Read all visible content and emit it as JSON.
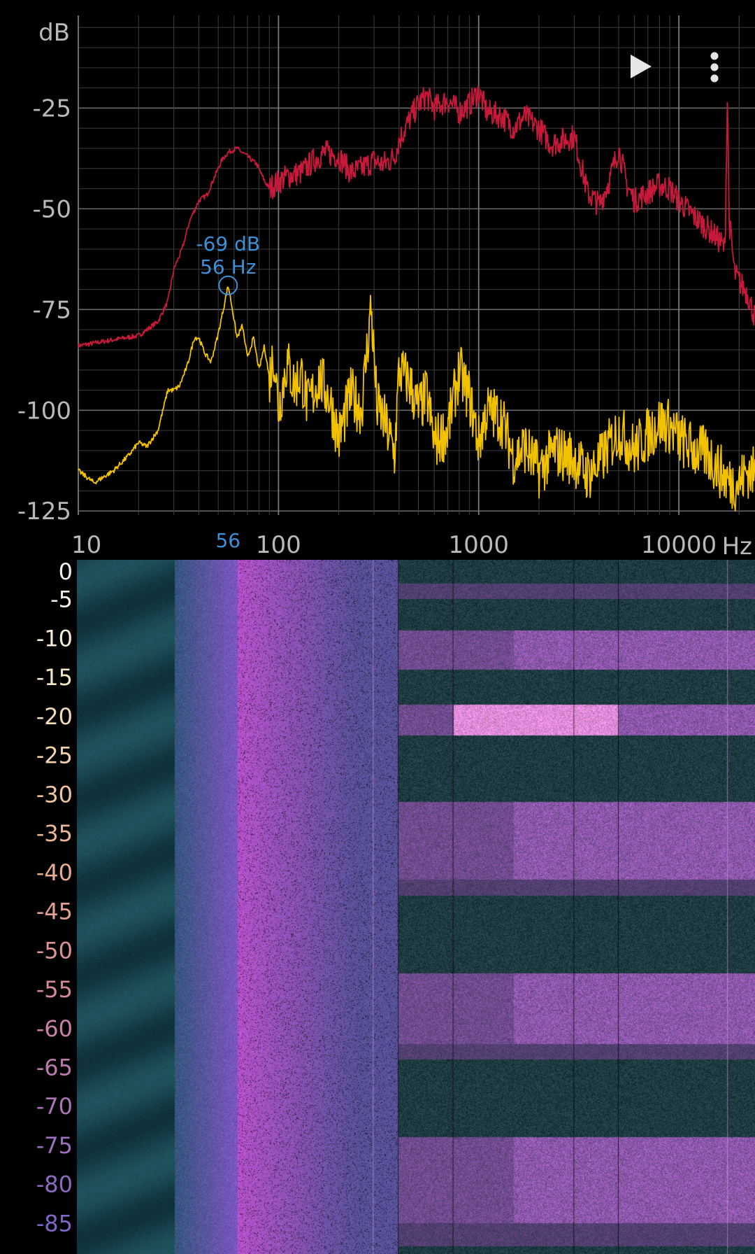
{
  "toolbar": {
    "play_icon": "play-icon",
    "menu_icon": "more-vertical-icon"
  },
  "marker": {
    "db_label": "-69 dB",
    "hz_label": "56 Hz",
    "freq_tick": "56",
    "freq_hz": 56,
    "db_value": -69,
    "color": "#3d8fd6"
  },
  "chart_data": [
    {
      "type": "line",
      "title": "",
      "xscale": "log",
      "xlim": [
        10,
        24000
      ],
      "ylim": [
        -126,
        -2
      ],
      "ylabel": "dB",
      "xlabel": "Hz",
      "y_ticks": [
        {
          "label": "-25",
          "value": -25
        },
        {
          "label": "-50",
          "value": -50
        },
        {
          "label": "-75",
          "value": -75
        },
        {
          "label": "-100",
          "value": -100
        },
        {
          "label": "-125",
          "value": -125
        }
      ],
      "x_ticks": [
        {
          "label": "10",
          "value": 10
        },
        {
          "label": "100",
          "value": 100
        },
        {
          "label": "1000",
          "value": 1000
        },
        {
          "label": "10000",
          "value": 10000
        }
      ],
      "grid": true,
      "series": [
        {
          "color": "#c8193a",
          "points": [
            [
              10,
              -84
            ],
            [
              15,
              -82.5
            ],
            [
              20,
              -81.5
            ],
            [
              25,
              -78
            ],
            [
              28,
              -73
            ],
            [
              30,
              -65
            ],
            [
              33,
              -60
            ],
            [
              36,
              -53
            ],
            [
              40,
              -48
            ],
            [
              44,
              -46.5
            ],
            [
              48,
              -42
            ],
            [
              52,
              -38
            ],
            [
              56,
              -36
            ],
            [
              62,
              -35
            ],
            [
              70,
              -37
            ],
            [
              78,
              -39
            ],
            [
              85,
              -43
            ],
            [
              90,
              -45
            ],
            [
              95,
              -44
            ],
            [
              110,
              -42
            ],
            [
              130,
              -41
            ],
            [
              150,
              -38
            ],
            [
              170,
              -36
            ],
            [
              200,
              -37
            ],
            [
              230,
              -41
            ],
            [
              260,
              -40
            ],
            [
              300,
              -38
            ],
            [
              330,
              -39
            ],
            [
              360,
              -38
            ],
            [
              380,
              -37
            ],
            [
              400,
              -33
            ],
            [
              450,
              -28
            ],
            [
              500,
              -24
            ],
            [
              550,
              -22
            ],
            [
              600,
              -25
            ],
            [
              700,
              -23
            ],
            [
              800,
              -26
            ],
            [
              900,
              -24
            ],
            [
              1000,
              -21
            ],
            [
              1100,
              -26
            ],
            [
              1300,
              -27
            ],
            [
              1500,
              -30
            ],
            [
              1700,
              -27
            ],
            [
              2000,
              -30
            ],
            [
              2300,
              -34
            ],
            [
              2600,
              -33
            ],
            [
              3000,
              -32
            ],
            [
              3500,
              -46
            ],
            [
              4000,
              -49
            ],
            [
              4500,
              -43
            ],
            [
              5000,
              -35
            ],
            [
              5500,
              -44
            ],
            [
              6000,
              -48
            ],
            [
              7000,
              -46
            ],
            [
              8000,
              -44
            ],
            [
              9000,
              -45
            ],
            [
              10000,
              -48
            ],
            [
              12000,
              -52
            ],
            [
              14000,
              -55
            ],
            [
              16000,
              -58
            ],
            [
              17000,
              -60
            ],
            [
              17500,
              -20
            ],
            [
              17800,
              -52
            ],
            [
              18000,
              -55
            ],
            [
              19000,
              -66
            ],
            [
              20000,
              -68
            ],
            [
              22000,
              -71
            ],
            [
              24000,
              -77
            ]
          ]
        },
        {
          "color": "#f2c200",
          "points": [
            [
              10,
              -115
            ],
            [
              12,
              -118
            ],
            [
              15,
              -115
            ],
            [
              18,
              -111
            ],
            [
              20,
              -108
            ],
            [
              22,
              -109
            ],
            [
              25,
              -105
            ],
            [
              28,
              -95
            ],
            [
              30,
              -95
            ],
            [
              32,
              -94
            ],
            [
              35,
              -89
            ],
            [
              38,
              -82
            ],
            [
              40,
              -82
            ],
            [
              43,
              -86
            ],
            [
              46,
              -88
            ],
            [
              50,
              -81
            ],
            [
              53,
              -75
            ],
            [
              56,
              -69
            ],
            [
              58,
              -73
            ],
            [
              62,
              -82
            ],
            [
              66,
              -79
            ],
            [
              70,
              -87
            ],
            [
              75,
              -82
            ],
            [
              80,
              -90
            ],
            [
              85,
              -84
            ],
            [
              90,
              -92
            ],
            [
              95,
              -86
            ],
            [
              100,
              -100
            ],
            [
              110,
              -88
            ],
            [
              120,
              -94
            ],
            [
              130,
              -91
            ],
            [
              140,
              -99
            ],
            [
              160,
              -92
            ],
            [
              180,
              -97
            ],
            [
              200,
              -107
            ],
            [
              230,
              -96
            ],
            [
              260,
              -100
            ],
            [
              290,
              -74
            ],
            [
              310,
              -99
            ],
            [
              340,
              -103
            ],
            [
              380,
              -111
            ],
            [
              400,
              -90
            ],
            [
              450,
              -93
            ],
            [
              500,
              -100
            ],
            [
              550,
              -96
            ],
            [
              600,
              -108
            ],
            [
              700,
              -105
            ],
            [
              800,
              -90
            ],
            [
              900,
              -97
            ],
            [
              1000,
              -108
            ],
            [
              1100,
              -100
            ],
            [
              1300,
              -102
            ],
            [
              1500,
              -112
            ],
            [
              1700,
              -109
            ],
            [
              2000,
              -115
            ],
            [
              2400,
              -110
            ],
            [
              3000,
              -112
            ],
            [
              3500,
              -116
            ],
            [
              4000,
              -113
            ],
            [
              5000,
              -105
            ],
            [
              6000,
              -110
            ],
            [
              7000,
              -106
            ],
            [
              8000,
              -103
            ],
            [
              9000,
              -104
            ],
            [
              10000,
              -107
            ],
            [
              12000,
              -110
            ],
            [
              14000,
              -111
            ],
            [
              16000,
              -115
            ],
            [
              18000,
              -118
            ],
            [
              20000,
              -118
            ],
            [
              22000,
              -115
            ],
            [
              24000,
              -116
            ]
          ]
        }
      ]
    },
    {
      "type": "heatmap",
      "title": "",
      "y_ticks": [
        "0",
        "-5",
        "-10",
        "-15",
        "-20",
        "-25",
        "-30",
        "-35",
        "-40",
        "-45",
        "-50",
        "-55",
        "-60",
        "-65",
        "-70",
        "-75",
        "-80",
        "-85"
      ],
      "ylim": [
        0,
        -89
      ],
      "xscale": "log",
      "xlim": [
        10,
        24000
      ],
      "bands": [
        {
          "start": -3,
          "end": -5
        },
        {
          "start": -9,
          "end": -14
        },
        {
          "start": -18.5,
          "end": -22.5
        },
        {
          "start": -31,
          "end": -41
        },
        {
          "start": -41,
          "end": -43
        },
        {
          "start": -53,
          "end": -62
        },
        {
          "start": -62,
          "end": -64
        },
        {
          "start": -74,
          "end": -85
        },
        {
          "start": -85,
          "end": -88
        }
      ],
      "colors": {
        "low": "#0b2b2e",
        "mid": "#3f4d8f",
        "high": "#c26fc0",
        "peak": "#f3b0b8"
      }
    }
  ]
}
